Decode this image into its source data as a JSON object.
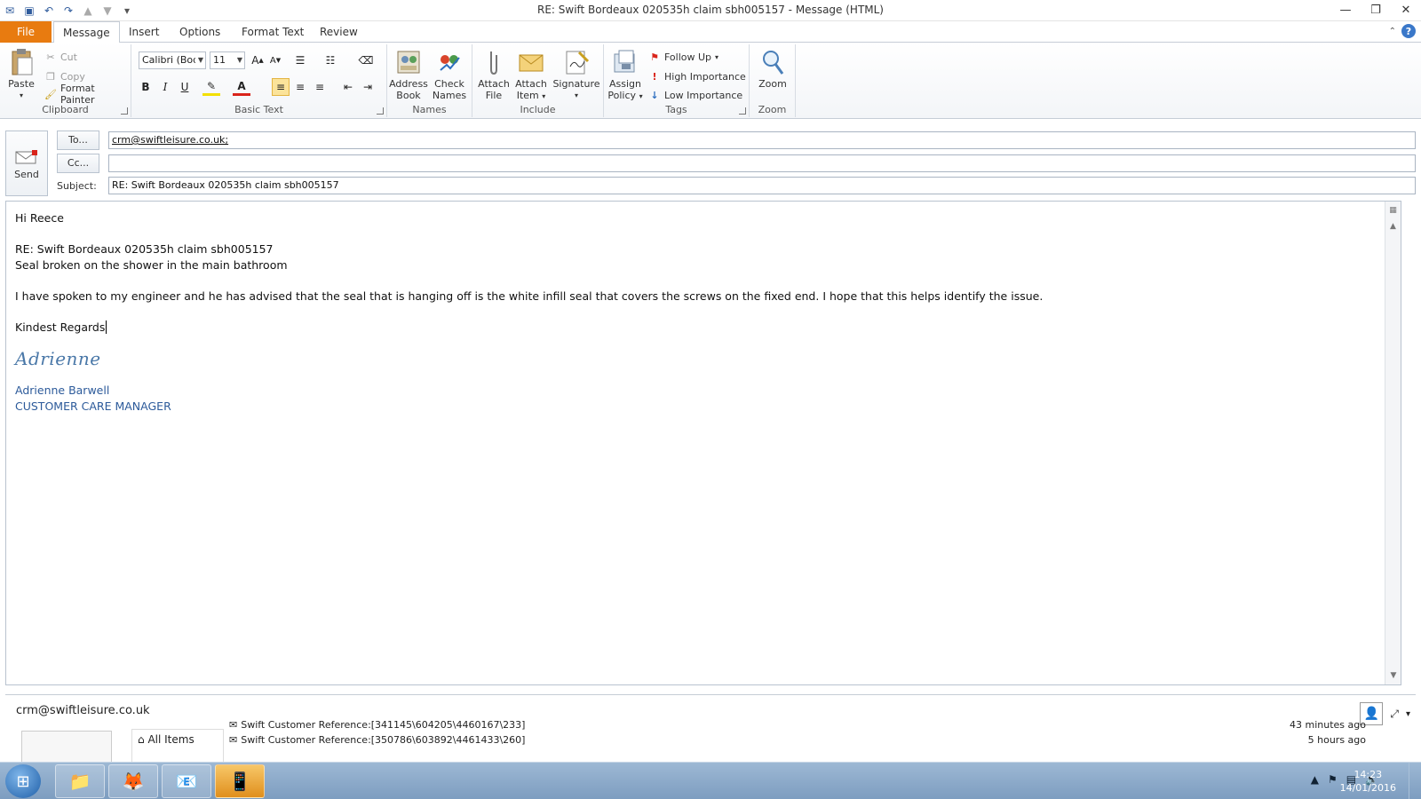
{
  "window": {
    "title": "RE: Swift Bordeaux  020535h  claim sbh005157  -  Message (HTML)"
  },
  "tabs": {
    "file": "File",
    "message": "Message",
    "insert": "Insert",
    "options": "Options",
    "format_text": "Format Text",
    "review": "Review"
  },
  "ribbon": {
    "clipboard": {
      "label": "Clipboard",
      "paste": "Paste",
      "cut": "Cut",
      "copy": "Copy",
      "format_painter": "Format Painter"
    },
    "basic_text": {
      "label": "Basic Text",
      "font": "Calibri (Body)",
      "size": "11",
      "bold": "B",
      "italic": "I",
      "underline": "U"
    },
    "names": {
      "label": "Names",
      "address_book_1": "Address",
      "address_book_2": "Book",
      "check_names_1": "Check",
      "check_names_2": "Names"
    },
    "include": {
      "label": "Include",
      "attach_file_1": "Attach",
      "attach_file_2": "File",
      "attach_item_1": "Attach",
      "attach_item_2": "Item",
      "signature": "Signature"
    },
    "tags": {
      "label": "Tags",
      "assign_policy_1": "Assign",
      "assign_policy_2": "Policy",
      "follow_up": "Follow Up",
      "high_importance": "High Importance",
      "low_importance": "Low Importance"
    },
    "zoom": {
      "label": "Zoom",
      "zoom_btn": "Zoom"
    }
  },
  "header": {
    "send": "Send",
    "to_btn": "To...",
    "cc_btn": "Cc...",
    "subject_label": "Subject:",
    "to_value": "crm@swiftleisure.co.uk;",
    "cc_value": "",
    "subject_value": "RE: Swift Bordeaux  020535h  claim sbh005157"
  },
  "body": {
    "greeting": "Hi Reece",
    "ref_line": "RE: Swift Bordeaux  020535h  claim sbh005157",
    "issue_line": "Seal broken on the shower in the main bathroom",
    "paragraph": "I have spoken to my engineer and he has advised that the seal that is hanging off is the white infill seal that covers the screws on the fixed end.  I hope that this helps identify the issue.",
    "closing": "Kindest Regards",
    "signature_script": "Adrienne",
    "sig_name": "Adrienne Barwell",
    "sig_title": "CUSTOMER CARE MANAGER"
  },
  "people_pane": {
    "email": "crm@swiftleisure.co.uk",
    "all_items": "All Items",
    "mail_items": [
      {
        "subject": "Swift Customer Reference:[341145\\604205\\4460167\\233]",
        "time": "43 minutes ago"
      },
      {
        "subject": "Swift Customer Reference:[350786\\603892\\4461433\\260]",
        "time": "5 hours ago"
      }
    ]
  },
  "taskbar": {
    "time": "14:23",
    "date": "14/01/2016"
  }
}
